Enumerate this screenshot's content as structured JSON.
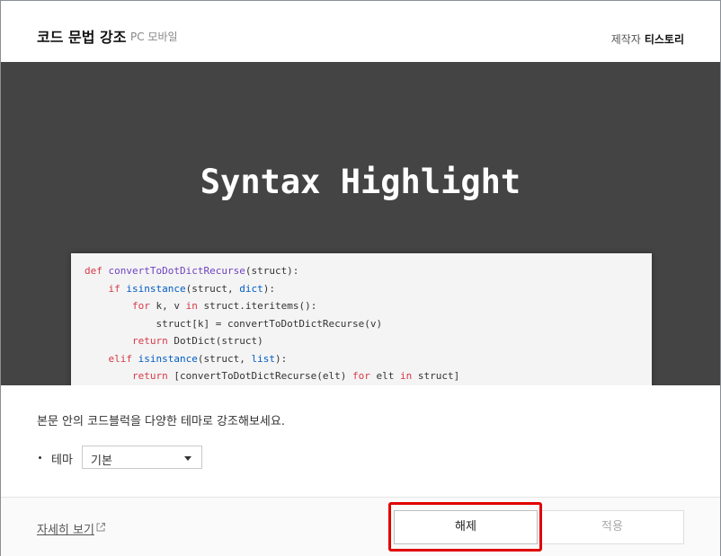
{
  "header": {
    "title": "코드 문법 강조",
    "subtitle": "PC 모바일",
    "author_label": "제작자",
    "author_name": "티스토리"
  },
  "preview": {
    "hero": "Syntax Highlight",
    "code_lines": [
      "def convertToDotDictRecurse(struct):",
      "    if isinstance(struct, dict):",
      "        for k, v in struct.iteritems():",
      "            struct[k] = convertToDotDictRecurse(v)",
      "        return DotDict(struct)",
      "    elif isinstance(struct, list):",
      "        return [convertToDotDictRecurse(elt) for elt in struct]"
    ]
  },
  "content": {
    "description": "본문 안의 코드블럭을 다양한 테마로 강조해보세요.",
    "theme_label": "테마",
    "theme_value": "기본"
  },
  "footer": {
    "more_link": "자세히 보기",
    "off_button": "해제",
    "apply_button": "적용"
  },
  "colors": {
    "preview_bg": "#444444",
    "keyword": "#d73a49",
    "function": "#6f42c1",
    "builtin": "#005cc5",
    "highlight_border": "#e10000"
  },
  "icons": {
    "external_link": "external-link-icon",
    "dropdown_caret": "chevron-down-icon"
  }
}
